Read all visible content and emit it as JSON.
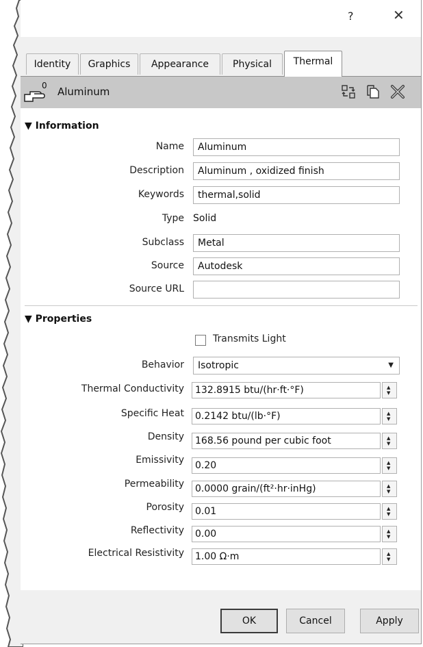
{
  "window": {
    "help_label": "?",
    "close_label": "✕"
  },
  "tabs": [
    {
      "label": "Identity"
    },
    {
      "label": "Graphics"
    },
    {
      "label": "Appearance"
    },
    {
      "label": "Physical"
    },
    {
      "label": "Thermal"
    }
  ],
  "active_tab": "Thermal",
  "asset": {
    "count": "0",
    "name": "Aluminum",
    "icons": [
      "replace-asset-icon",
      "duplicate-asset-icon",
      "remove-asset-icon"
    ]
  },
  "information": {
    "title": "▼ Information",
    "name_label": "Name",
    "name_value": "Aluminum",
    "description_label": "Description",
    "description_value": "Aluminum , oxidized finish",
    "keywords_label": "Keywords",
    "keywords_value": "thermal,solid",
    "type_label": "Type",
    "type_value": "Solid",
    "subclass_label": "Subclass",
    "subclass_value": "Metal",
    "source_label": "Source",
    "source_value": "Autodesk",
    "source_url_label": "Source URL",
    "source_url_value": ""
  },
  "properties": {
    "title": "▼ Properties",
    "transmits_light_label": "Transmits Light",
    "transmits_light_checked": false,
    "behavior_label": "Behavior",
    "behavior_value": "Isotropic",
    "rows": [
      {
        "label": "Thermal Conductivity",
        "value": "132.8915 btu/(hr·ft·°F)"
      },
      {
        "label": "Specific Heat",
        "value": "0.2142 btu/(lb·°F)"
      },
      {
        "label": "Density",
        "value": "168.56 pound per cubic foot"
      },
      {
        "label": "Emissivity",
        "value": "0.20"
      },
      {
        "label": "Permeability",
        "value": "0.0000 grain/(ft²·hr·inHg)"
      },
      {
        "label": "Porosity",
        "value": "0.01"
      },
      {
        "label": "Reflectivity",
        "value": "0.00"
      },
      {
        "label": "Electrical Resistivity",
        "value": "1.00 Ω·m"
      }
    ]
  },
  "buttons": {
    "ok": "OK",
    "cancel": "Cancel",
    "apply": "Apply"
  }
}
